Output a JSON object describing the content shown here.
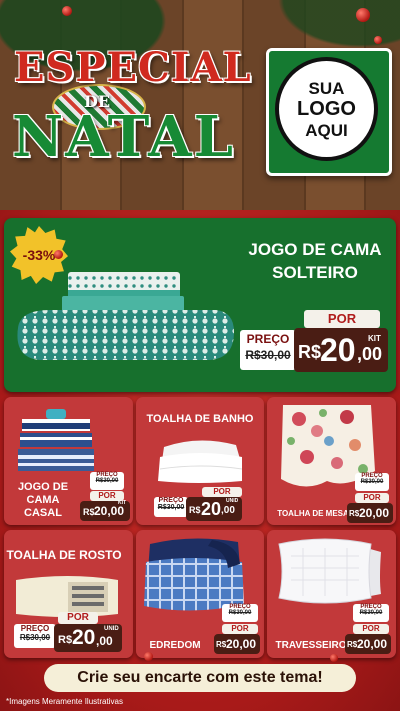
{
  "header": {
    "title_line1": "ESPECIAL",
    "title_de": "DE",
    "title_line2": "NATAL",
    "logo_line1": "SUA",
    "logo_line2": "LOGO",
    "logo_line3": "AQUI"
  },
  "featured": {
    "discount": "-33%",
    "title_line1": "JOGO DE CAMA",
    "title_line2": "SOLTEIRO",
    "preco_label": "PREÇO",
    "old_price": "R$30,00",
    "por_label": "POR",
    "currency": "R$",
    "price_int": "20",
    "price_dec": ",00",
    "unit": "KIT"
  },
  "products": [
    {
      "name_line1": "JOGO DE",
      "name_line2": "CAMA",
      "name_line3": "CASAL",
      "preco_label": "PREÇO",
      "old_price": "R$30,00",
      "por_label": "POR",
      "currency": "R$",
      "price": "20,00",
      "unit": "KIT"
    },
    {
      "name": "TOALHA DE BANHO",
      "preco_label": "PREÇO",
      "old_price": "R$30,00",
      "por_label": "POR",
      "currency": "R$",
      "price_int": "20",
      "price_dec": ",00",
      "unit": "UNID"
    },
    {
      "name": "TOALHA DE MESA",
      "preco_label": "PREÇO",
      "old_price": "R$30,00",
      "por_label": "POR",
      "currency": "R$",
      "price": "20,00",
      "unit": "UNID"
    },
    {
      "name": "TOALHA DE ROSTO",
      "preco_label": "PREÇO",
      "old_price": "R$30,00",
      "por_label": "POR",
      "currency": "R$",
      "price_int": "20",
      "price_dec": ",00",
      "unit": "UNID"
    },
    {
      "name": "EDREDOM",
      "preco_label": "PREÇO",
      "old_price": "R$30,00",
      "por_label": "POR",
      "currency": "R$",
      "price": "20,00",
      "unit": "UNID"
    },
    {
      "name": "TRAVESSEIRO",
      "preco_label": "PREÇO",
      "old_price": "R$30,00",
      "por_label": "POR",
      "currency": "R$",
      "price": "20,00",
      "unit": "UNID"
    }
  ],
  "cta_label": "Crie seu encarte com este tema!",
  "disclaimer": "*Imagens Meramente Ilustrativas",
  "colors": {
    "green": "#17702d",
    "red": "#b8211f",
    "gold": "#f2c229",
    "dark_tag": "#4a1d14"
  }
}
